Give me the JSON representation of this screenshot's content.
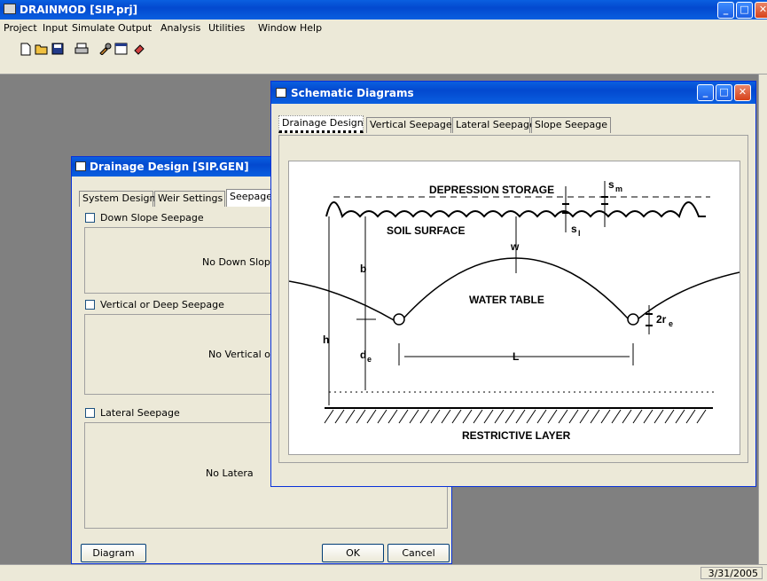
{
  "app": {
    "title": "DRAINMOD [SIP.prj]",
    "menu": [
      "Project",
      "Input",
      "Simulate",
      "Output",
      "Analysis",
      "Utilities",
      "Window",
      "Help"
    ],
    "toolbar_icons": [
      "new-file-icon",
      "open-folder-icon",
      "save-icon",
      "print-icon",
      "tools-icon",
      "window-icon",
      "eraser-icon"
    ]
  },
  "drainage_dialog": {
    "title": "Drainage Design [SIP.GEN]",
    "tabs": [
      "System Design",
      "Weir Settings",
      "Seepage"
    ],
    "sections": [
      {
        "checkbox_label": "Down Slope Seepage",
        "message": "No Down Slop"
      },
      {
        "checkbox_label": "Vertical or Deep Seepage",
        "message": "No Vertical or"
      },
      {
        "checkbox_label": "Lateral Seepage",
        "message": "No Latera"
      }
    ],
    "diagram_button": "Diagram",
    "ok_button": "OK",
    "cancel_button": "Cancel"
  },
  "schematic_dialog": {
    "title": "Schematic Diagrams",
    "tabs": [
      "Drainage Design",
      "Vertical Seepage",
      "Lateral Seepage",
      "Slope Seepage"
    ],
    "diagram_labels": {
      "depression_storage": "DEPRESSION STORAGE",
      "soil_surface": "SOIL SURFACE",
      "water_table": "WATER TABLE",
      "restrictive_layer": "RESTRICTIVE LAYER",
      "sm": "s",
      "sm_sub": "m",
      "si": "s",
      "si_sub": "l",
      "w": "w",
      "b": "b",
      "h": "h",
      "de": "d",
      "de_sub": "e",
      "L": "L",
      "re": "2r",
      "re_sub": "e"
    }
  },
  "status": {
    "date": "3/31/2005"
  },
  "colors": {
    "title_blue": "#0349cf",
    "close_red": "#d6421a",
    "dialog_face": "#ece9d8",
    "workspace": "#808080"
  }
}
